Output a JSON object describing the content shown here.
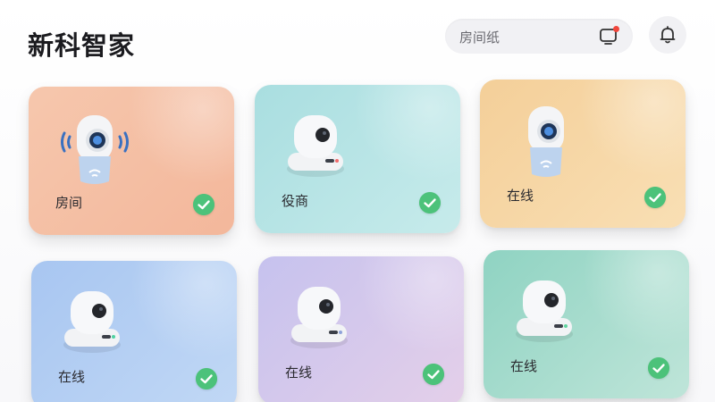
{
  "header": {
    "title": "新科智家",
    "search_text": "房间纸",
    "tv_icon": "tv-notification-icon",
    "bell_icon": "bell-icon",
    "notification_dot_color": "#f0463c"
  },
  "devices": [
    {
      "label": "房间",
      "camera": "tall-camera-with-signal",
      "status": "checked",
      "bg": "#f4bc9f"
    },
    {
      "label": "役商",
      "camera": "dome-camera",
      "status": "checked",
      "bg": "#b4e2e3"
    },
    {
      "label": "在线",
      "camera": "tall-camera",
      "status": "checked",
      "bg": "#f6d7a5"
    },
    {
      "label": "在线",
      "camera": "dome-camera",
      "status": "checked",
      "bg": "#b3cff3"
    },
    {
      "label": "在线",
      "camera": "dome-camera",
      "status": "checked",
      "bg": "#d4c8ec"
    },
    {
      "label": "在线",
      "camera": "dome-camera",
      "status": "checked",
      "bg": "#a6dccd"
    }
  ],
  "colors": {
    "check_green": "#4cc27a",
    "title_text": "#1b1b1f"
  }
}
